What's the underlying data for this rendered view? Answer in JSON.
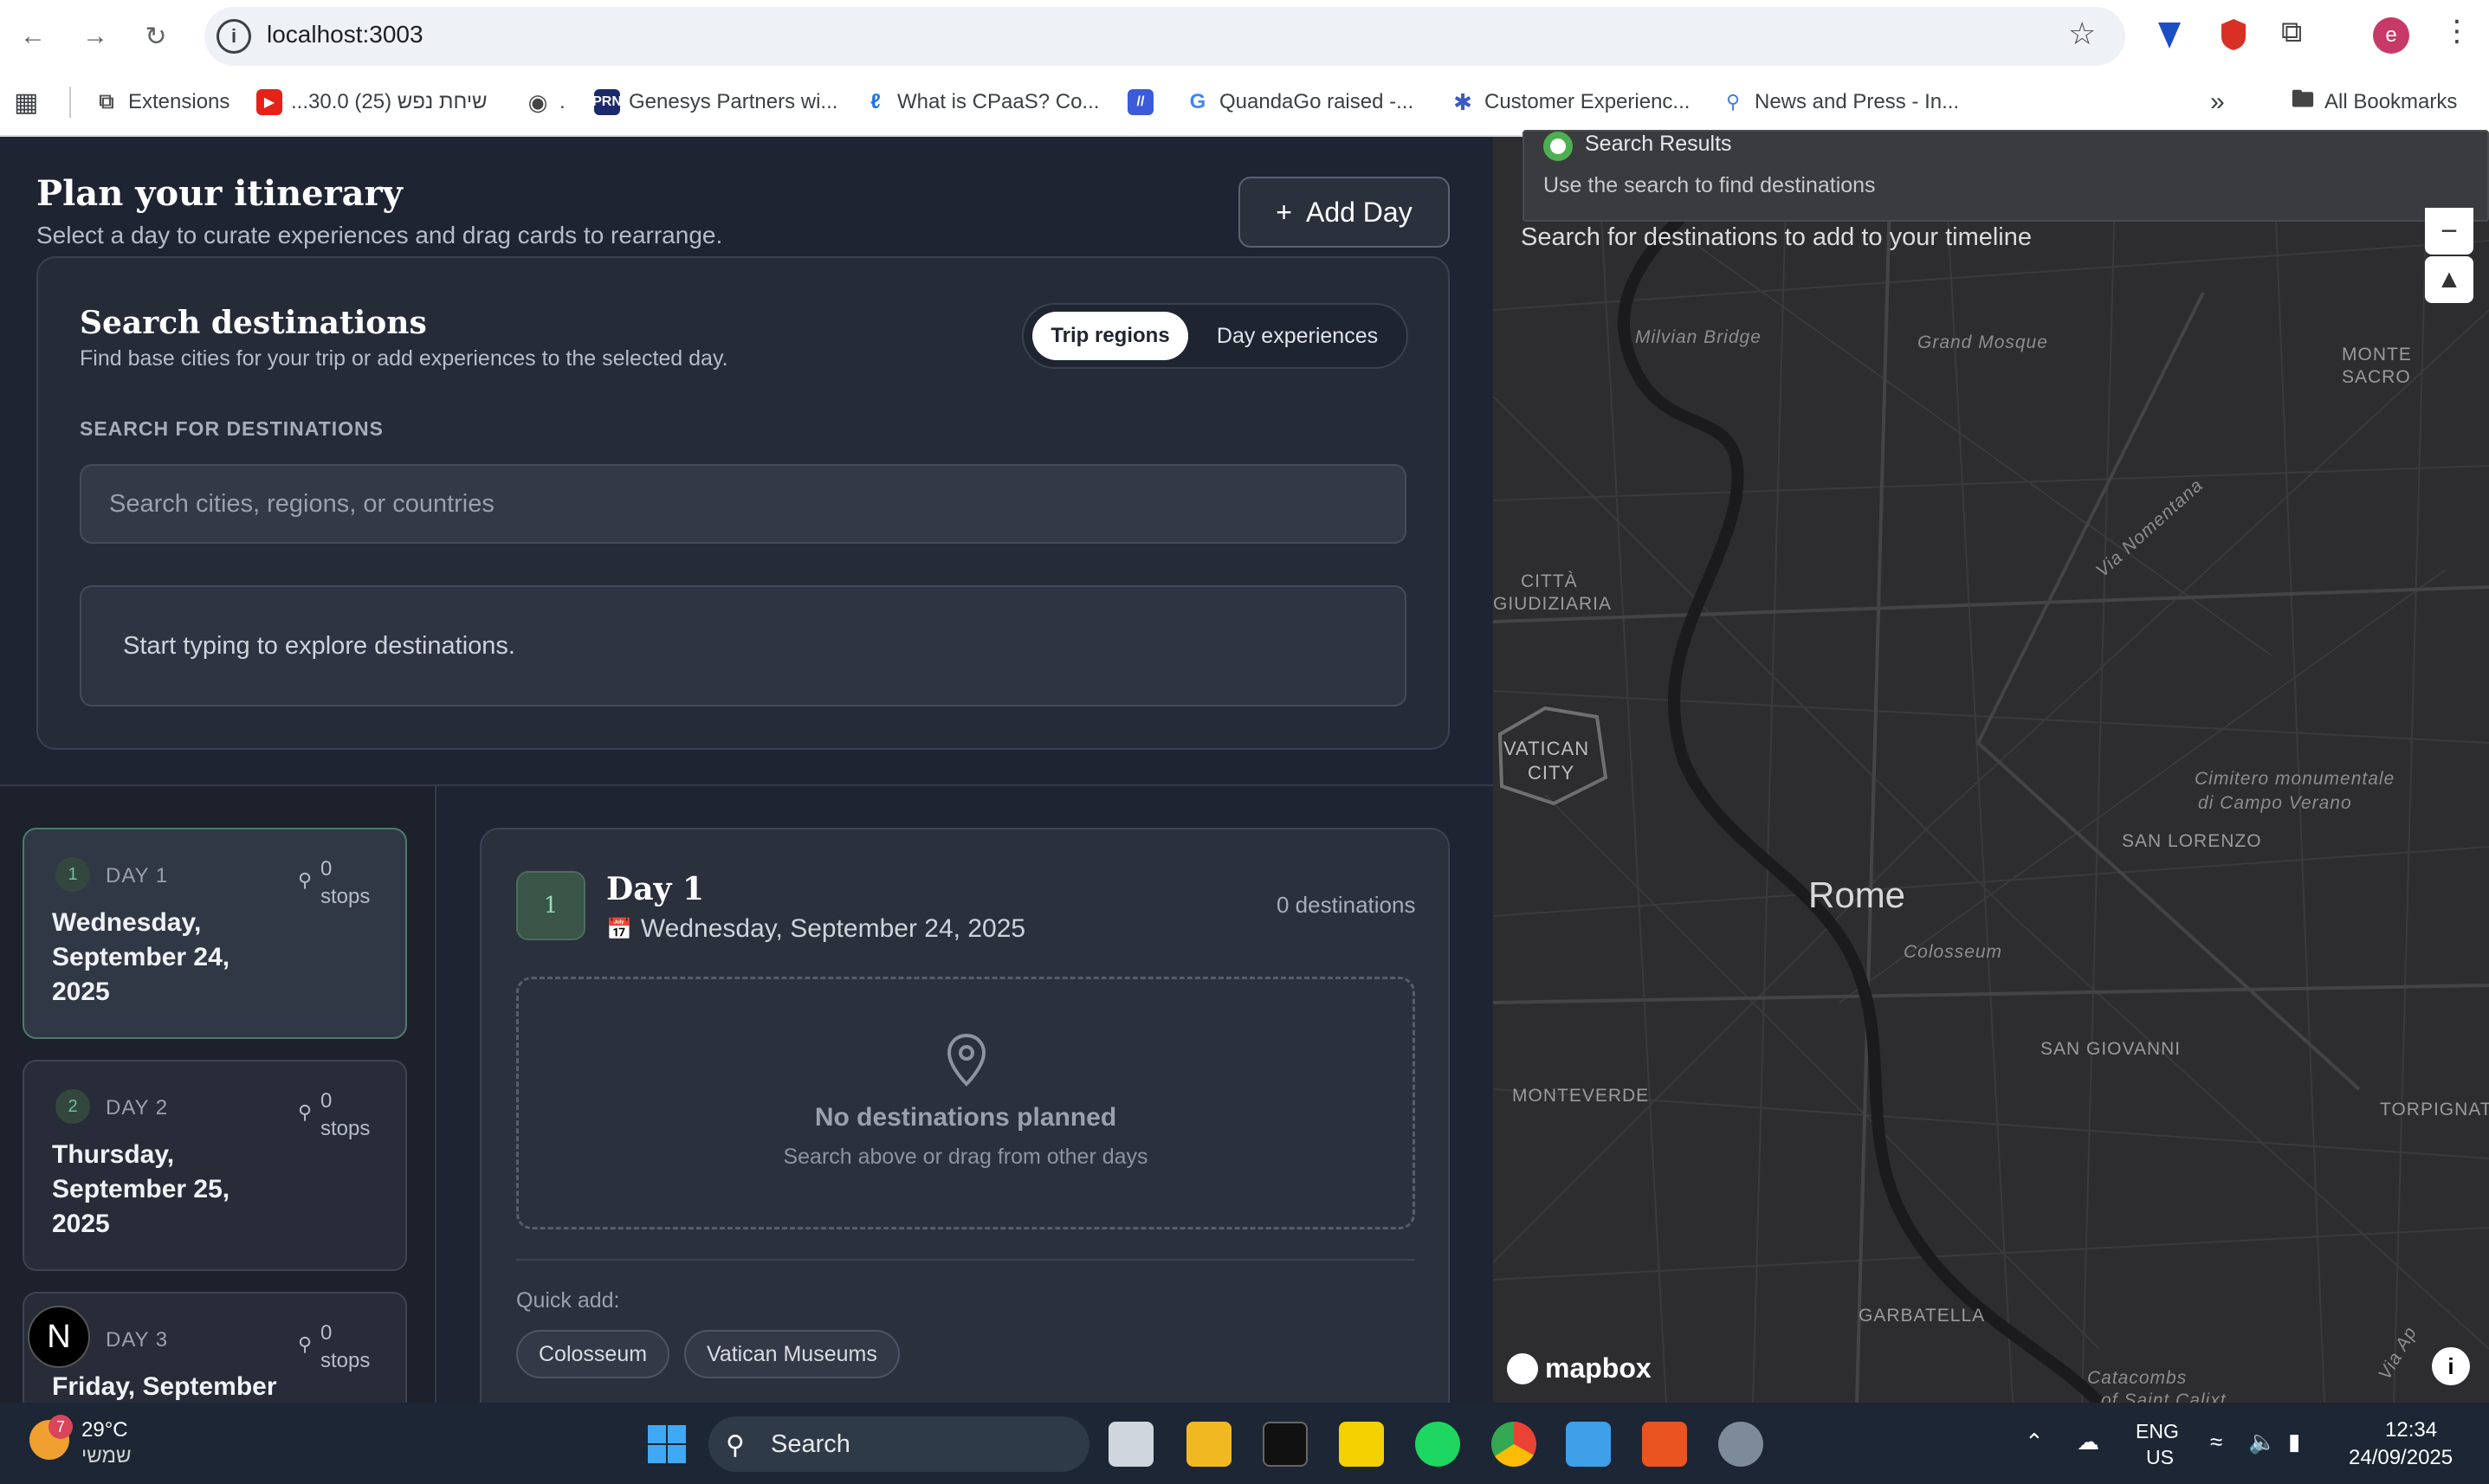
{
  "browser": {
    "url": "localhost:3003",
    "bookmarks": [
      "Extensions",
      "...30.0 שיחת נפש (25)",
      ".",
      "Genesys Partners wi...",
      "What is CPaaS? Co...",
      "QuandaGo raised -...",
      "Customer Experienc...",
      "News and Press - In...",
      "All Bookmarks"
    ],
    "profile_initial": "e"
  },
  "header": {
    "title": "Plan your itinerary",
    "subtitle": "Select a day to curate experiences and drag cards to rearrange.",
    "add_day_label": "Add Day"
  },
  "search": {
    "title": "Search destinations",
    "subtitle": "Find base cities for your trip or add experiences to the selected day.",
    "toggle_trip": "Trip regions",
    "toggle_day": "Day experiences",
    "label": "SEARCH FOR DESTINATIONS",
    "placeholder": "Search cities, regions, or countries",
    "results_hint": "Start typing to explore destinations."
  },
  "days": [
    {
      "num": "1",
      "label": "DAY 1",
      "date": "Wednesday, September 24, 2025",
      "stops_num": "0",
      "stops_word": "stops"
    },
    {
      "num": "2",
      "label": "DAY 2",
      "date": "Thursday, September 25, 2025",
      "stops_num": "0",
      "stops_word": "stops"
    },
    {
      "num": "3",
      "label": "DAY 3",
      "date": "Friday, September",
      "stops_num": "0",
      "stops_word": "stops"
    }
  ],
  "detail": {
    "badge": "1",
    "title": "Day 1",
    "date": "Wednesday, September 24, 2025",
    "dest_count": "0 destinations",
    "empty_title": "No destinations planned",
    "empty_sub": "Search above or drag from other days",
    "quick_label": "Quick add:",
    "quick_chips": [
      "Colosseum",
      "Vatican Museums"
    ]
  },
  "next_badge": "N",
  "map": {
    "popup_title": "Search Results",
    "popup_sub": "Use the search to find destinations",
    "hint": "Search for destinations to add to your timeline",
    "city": "Rome",
    "labels": {
      "milvian": "Milvian Bridge",
      "mosque": "Grand Mosque",
      "monte_sacro_1": "MONTE",
      "monte_sacro_2": "SACRO",
      "citta_1": "CITTÀ",
      "citta_2": "GIUDIZIARIA",
      "nomentana": "Via Nomentana",
      "vatican_1": "VATICAN",
      "vatican_2": "CITY",
      "cimitero_1": "Cimitero monumentale",
      "cimitero_2": "di Campo Verano",
      "lorenzo": "SAN LORENZO",
      "colosseum": "Colosseum",
      "giovanni": "SAN GIOVANNI",
      "monteverde": "MONTEVERDE",
      "torpignattara": "TORPIGNATT",
      "garbatella": "GARBATELLA",
      "catacombs_1": "Catacombs",
      "catacombs_2": "of Saint Calixt",
      "via_a": "Via Ap"
    },
    "attribution": "mapbox"
  },
  "taskbar": {
    "temp": "29°C",
    "weekday": "שמשי",
    "weather_badge": "7",
    "search": "Search",
    "lang1": "ENG",
    "lang2": "US",
    "time": "12:34",
    "date": "24/09/2025"
  }
}
